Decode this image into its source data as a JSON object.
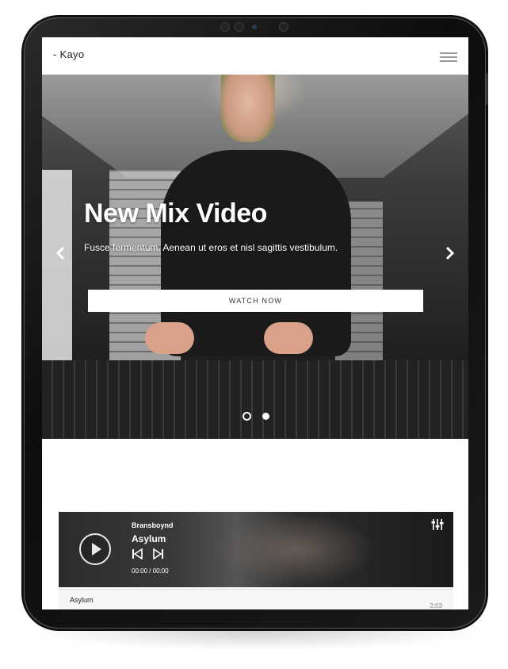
{
  "header": {
    "logo": "- Kayo"
  },
  "hero": {
    "title": "New Mix Video",
    "subtitle": "Fusce fermentum. Aenean ut eros et nisl sagittis vestibulum.",
    "button_label": "WATCH NOW",
    "prev_arrow": "‹",
    "next_arrow": "›",
    "slides_total": 2,
    "active_slide": 2
  },
  "player": {
    "artist": "Bransboynd",
    "title": "Asylum",
    "time": "00:00 / 00:00"
  },
  "playlist": [
    {
      "title": "Asylum",
      "duration": "2:03"
    }
  ]
}
